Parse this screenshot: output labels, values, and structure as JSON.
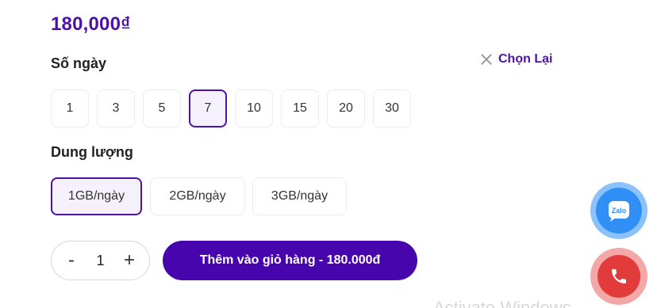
{
  "price": "180,000₫",
  "days": {
    "label": "Số ngày",
    "options": [
      "1",
      "3",
      "5",
      "7",
      "10",
      "15",
      "20",
      "30"
    ],
    "selected": "7"
  },
  "reset": {
    "label": "Chọn Lại",
    "icon": "close-icon"
  },
  "data_plan": {
    "label": "Dung lượng",
    "options": [
      "1GB/ngày",
      "2GB/ngày",
      "3GB/ngày"
    ],
    "selected": "1GB/ngày"
  },
  "quantity": {
    "decrement": "-",
    "value": "1",
    "increment": "+"
  },
  "add_to_cart": {
    "label": "Thêm vào giỏ hàng - 180.000đ"
  },
  "watermark": "Activate Windows",
  "floating": {
    "zalo": {
      "icon": "zalo-icon",
      "text": "Zalo"
    },
    "phone": {
      "icon": "phone-icon"
    }
  },
  "colors": {
    "accent": "#4c12a8",
    "button": "#4706ad",
    "zalo": "#2f8ff5",
    "phone": "#e23b3b"
  }
}
